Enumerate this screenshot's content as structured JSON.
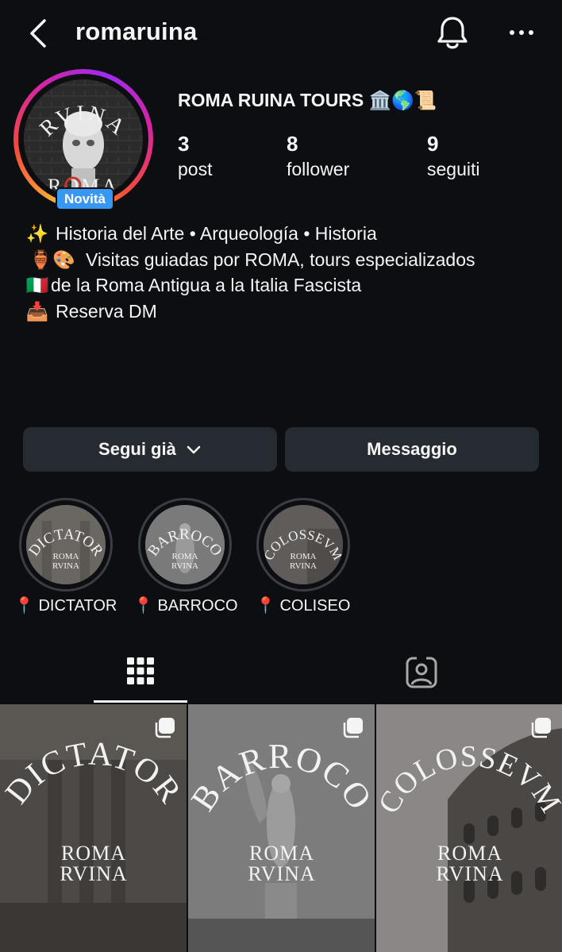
{
  "header": {
    "username": "romaruina"
  },
  "profile": {
    "display_name": "ROMA RUINA TOURS 🏛️🌎📜",
    "new_badge": "Novità",
    "avatar_text_top": "RVINA",
    "avatar_text_bottom": "ROMA",
    "stats": [
      {
        "value": "3",
        "label": "post"
      },
      {
        "value": "8",
        "label": "follower"
      },
      {
        "value": "9",
        "label": "seguiti"
      }
    ],
    "bio": [
      {
        "emoji": "✨",
        "text": "Historia del Arte • Arqueología • Historia"
      },
      {
        "emoji": "🏺🎨",
        "text": "Visitas guiadas por ROMA, tours especializados"
      },
      {
        "emoji": "🇮🇹",
        "text": "de la Roma Antigua a la Italia Fascista"
      },
      {
        "emoji": "📥",
        "text": "Reserva DM"
      }
    ]
  },
  "actions": {
    "follow": "Segui già",
    "message": "Messaggio"
  },
  "highlights": [
    {
      "label": "📍 DICTATOR",
      "cover_word": "DICTATOR"
    },
    {
      "label": "📍 BARROCO",
      "cover_word": "BARROCO"
    },
    {
      "label": "📍 COLISEO",
      "cover_word": "COLOSSEVM"
    }
  ],
  "posts": [
    {
      "word": "DICTATOR",
      "brand_top": "ROMA",
      "brand_bottom": "RVINA"
    },
    {
      "word": "BARROCO",
      "brand_top": "ROMA",
      "brand_bottom": "RVINA"
    },
    {
      "word": "COLOSSEVM",
      "brand_top": "ROMA",
      "brand_bottom": "RVINA"
    }
  ],
  "colors": {
    "background": "#0c0e12",
    "button": "#262a31",
    "badge": "#3897f0",
    "accent_red": "#c0392b"
  },
  "icons": [
    "back-arrow-icon",
    "bell-icon",
    "more-icon",
    "grid-icon",
    "tagged-icon",
    "multi-post-icon",
    "chevron-down-icon"
  ]
}
